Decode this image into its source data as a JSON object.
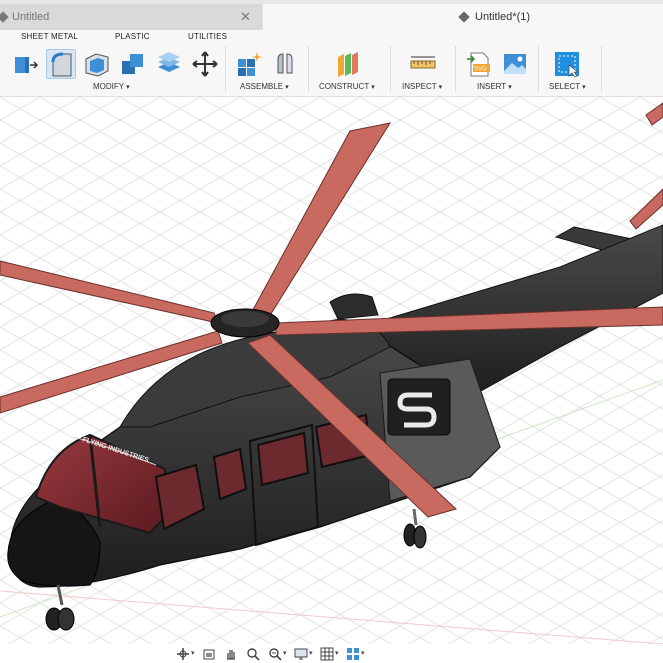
{
  "tabs": [
    {
      "label": "Untitled",
      "active": false,
      "close_icon": "close-icon"
    },
    {
      "label": "Untitled*(1)",
      "active": true
    }
  ],
  "workspace_tabs": [
    "SHEET METAL",
    "PLASTIC",
    "UTILITIES"
  ],
  "toolbar_groups": [
    {
      "label": "MODIFY",
      "tools": [
        "press-pull-icon",
        "fillet-icon",
        "shell-icon",
        "combine-icon",
        "offset-face-icon",
        "move-copy-icon"
      ]
    },
    {
      "label": "ASSEMBLE",
      "tools": [
        "new-component-icon",
        "joint-icon"
      ]
    },
    {
      "label": "CONSTRUCT",
      "tools": [
        "offset-plane-icon"
      ]
    },
    {
      "label": "INSPECT",
      "tools": [
        "measure-icon"
      ]
    },
    {
      "label": "INSERT",
      "tools": [
        "insert-svg-icon",
        "canvas-image-icon"
      ]
    },
    {
      "label": "SELECT",
      "tools": [
        "select-icon"
      ]
    }
  ],
  "dropdown_caret": "▾",
  "model": {
    "decal_text": "FLYING INDUSTRIES",
    "body_color": "#2a2a2a",
    "rotor_color": "#c96a61",
    "glass_color": "#7a2a2f"
  },
  "nav_bar": [
    "orbit-icon",
    "look-at-icon",
    "pan-icon",
    "zoom-icon",
    "fit-icon",
    "display-settings-icon",
    "grid-settings-icon",
    "viewports-icon"
  ],
  "colors": {
    "accent": "#0696d7",
    "grid": "#e2e2e2"
  }
}
